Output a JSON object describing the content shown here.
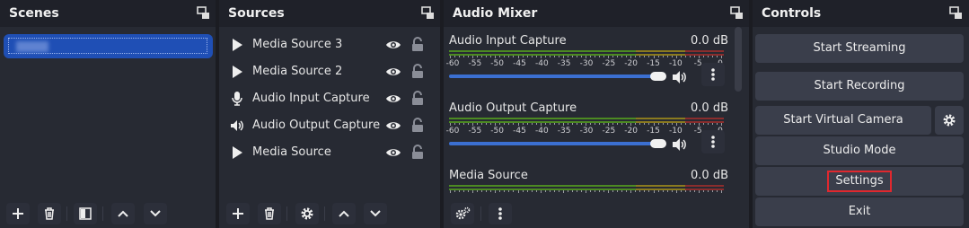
{
  "scenes": {
    "title": "Scenes",
    "selected_scene": ""
  },
  "sources": {
    "title": "Sources",
    "items": [
      {
        "label": "Media Source 3",
        "icon": "play-icon"
      },
      {
        "label": "Media Source 2",
        "icon": "play-icon"
      },
      {
        "label": "Audio Input Capture",
        "icon": "microphone-icon"
      },
      {
        "label": "Audio Output Capture",
        "icon": "speaker-icon"
      },
      {
        "label": "Media Source",
        "icon": "play-icon"
      }
    ]
  },
  "mixer": {
    "title": "Audio Mixer",
    "scale": [
      "-60",
      "-55",
      "-50",
      "-45",
      "-40",
      "-35",
      "-30",
      "-25",
      "-20",
      "-15",
      "-10",
      "-5",
      "0"
    ],
    "channels": [
      {
        "name": "Audio Input Capture",
        "level": "0.0 dB"
      },
      {
        "name": "Audio Output Capture",
        "level": "0.0 dB"
      },
      {
        "name": "Media Source",
        "level": "0.0 dB"
      }
    ]
  },
  "controls": {
    "title": "Controls",
    "start_streaming": "Start Streaming",
    "start_recording": "Start Recording",
    "start_virtual_camera": "Start Virtual Camera",
    "studio_mode": "Studio Mode",
    "settings": "Settings",
    "exit": "Exit"
  },
  "colors": {
    "accent": "#1f4fb5",
    "meter_green": "#4c8a22",
    "meter_yellow": "#8a7a1f",
    "meter_red": "#8a2d2d",
    "highlight": "#e0282e"
  }
}
